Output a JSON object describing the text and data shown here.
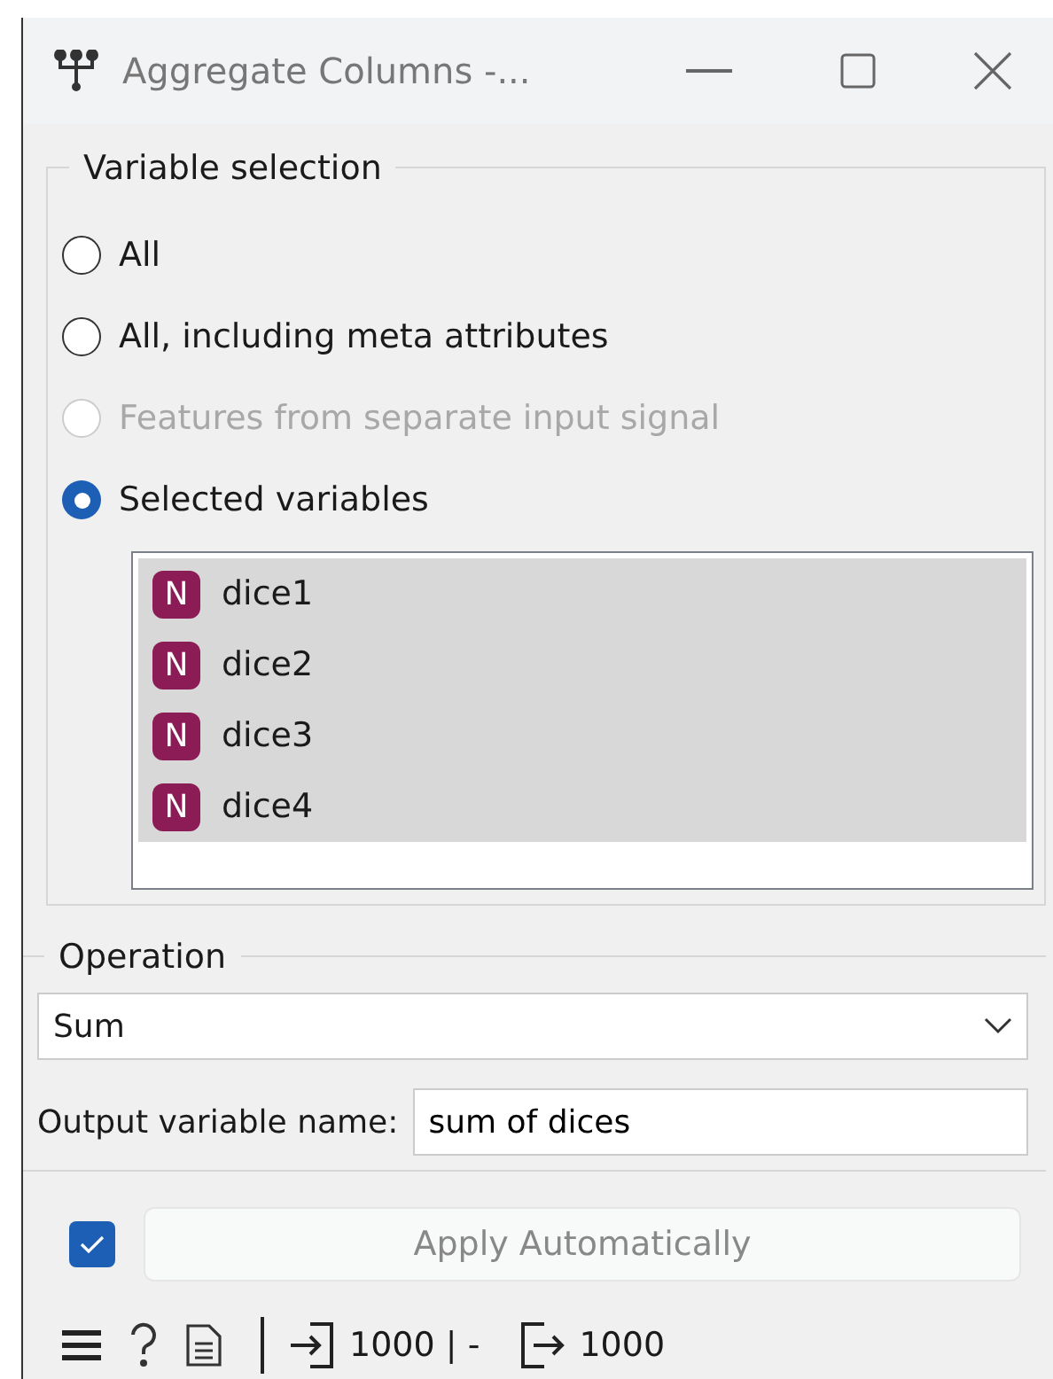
{
  "window": {
    "title": "Aggregate Columns -..."
  },
  "variable_selection": {
    "title": "Variable selection",
    "options": [
      {
        "label": "All",
        "selected": false,
        "disabled": false
      },
      {
        "label": "All, including meta attributes",
        "selected": false,
        "disabled": false
      },
      {
        "label": "Features from separate input signal",
        "selected": false,
        "disabled": true
      },
      {
        "label": "Selected variables",
        "selected": true,
        "disabled": false
      }
    ],
    "variables": [
      {
        "type": "N",
        "name": "dice1",
        "selected": true
      },
      {
        "type": "N",
        "name": "dice2",
        "selected": true
      },
      {
        "type": "N",
        "name": "dice3",
        "selected": true
      },
      {
        "type": "N",
        "name": "dice4",
        "selected": true
      }
    ]
  },
  "operation": {
    "title": "Operation",
    "value": "Sum",
    "output_label": "Output variable name:",
    "output_value": "sum of dices"
  },
  "apply": {
    "checked": true,
    "label": "Apply Automatically"
  },
  "status_bar": {
    "input": "1000 | -",
    "output": "1000"
  }
}
